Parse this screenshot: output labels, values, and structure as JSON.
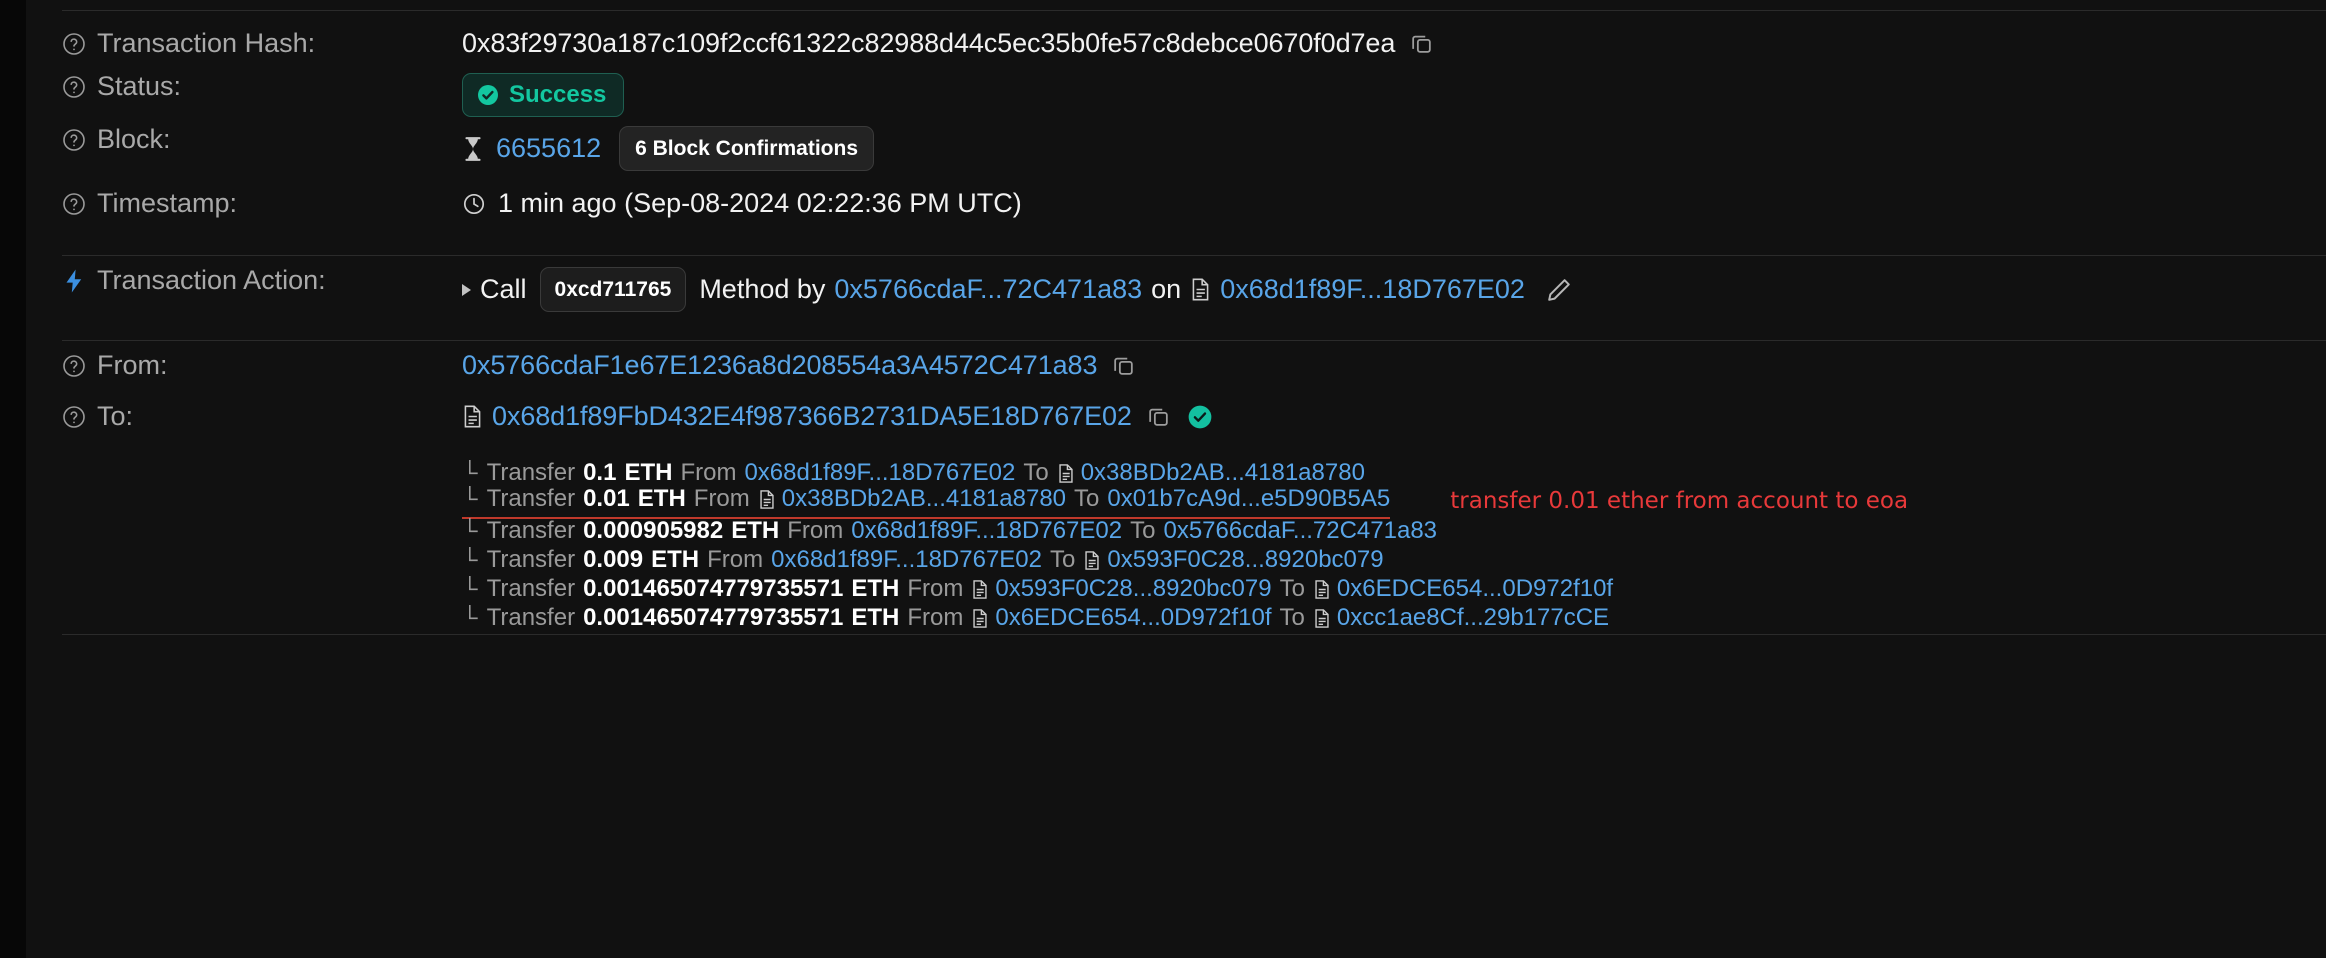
{
  "rows": {
    "transaction_hash": {
      "label": "Transaction Hash:",
      "value": "0x83f29730a187c109f2ccf61322c82988d44c5ec35b0fe57c8debce0670f0d7ea",
      "copy_icon": "copy-icon",
      "help_icon": "help-circle-icon"
    },
    "status": {
      "label": "Status:",
      "value": "Success",
      "badge_icon": "check-circle-icon",
      "badge_color": "#13c7a0",
      "badge_bg": "#0f2a25",
      "badge_border": "#1f5f51",
      "help_icon": "help-circle-icon"
    },
    "block": {
      "label": "Block:",
      "number": "6655612",
      "confirmations": "6 Block Confirmations",
      "block_icon": "hourglass-icon",
      "help_icon": "help-circle-icon"
    },
    "timestamp": {
      "label": "Timestamp:",
      "value": "1 min ago (Sep-08-2024 02:22:36 PM UTC)",
      "clock_icon": "clock-icon",
      "help_icon": "help-circle-icon"
    },
    "transaction_action": {
      "label": "Transaction Action:",
      "bolt_icon": "lightning-bolt-icon",
      "caret_icon": "caret-right-icon",
      "call_word": "Call",
      "method_id": "0xcd711765",
      "method_by_word": "Method by",
      "caller": "0x5766cdaF...72C471a83",
      "on_word": "on",
      "contract": "0x68d1f89F...18D767E02",
      "contract_icon": "contract-document-icon",
      "edit_icon": "pencil-icon"
    },
    "from": {
      "label": "From:",
      "value": "0x5766cdaF1e67E1236a8d208554a3A4572C471a83",
      "copy_icon": "copy-icon",
      "help_icon": "help-circle-icon"
    },
    "to": {
      "label": "To:",
      "value": "0x68d1f89FbD432E4f987366B2731DA5E18D767E02",
      "contract_icon": "contract-document-icon",
      "copy_icon": "copy-icon",
      "verified_icon": "verified-check-icon",
      "help_icon": "help-circle-icon"
    }
  },
  "transfers": {
    "prefix": "Transfer",
    "from_word": "From",
    "to_word": "To",
    "eth_unit": "ETH",
    "corner_glyph": "└",
    "items": [
      {
        "amount": "0.1",
        "from": "0x68d1f89F...18D767E02",
        "from_is_contract": false,
        "to": "0x38BDb2AB...4181a8780",
        "to_is_contract": true,
        "annotation": "",
        "underlined": false
      },
      {
        "amount": "0.01",
        "from": "0x38BDb2AB...4181a8780",
        "from_is_contract": true,
        "to": "0x01b7cA9d...e5D90B5A5",
        "to_is_contract": false,
        "annotation": "transfer 0.01 ether from account to eoa",
        "underlined": true
      },
      {
        "amount": "0.000905982",
        "from": "0x68d1f89F...18D767E02",
        "from_is_contract": false,
        "to": "0x5766cdaF...72C471a83",
        "to_is_contract": false,
        "annotation": "",
        "underlined": false
      },
      {
        "amount": "0.009",
        "from": "0x68d1f89F...18D767E02",
        "from_is_contract": false,
        "to": "0x593F0C28...8920bc079",
        "to_is_contract": true,
        "annotation": "",
        "underlined": false
      },
      {
        "amount": "0.001465074779735571",
        "from": "0x593F0C28...8920bc079",
        "from_is_contract": true,
        "to": "0x6EDCE654...0D972f10f",
        "to_is_contract": true,
        "annotation": "",
        "underlined": false
      },
      {
        "amount": "0.001465074779735571",
        "from": "0x6EDCE654...0D972f10f",
        "from_is_contract": true,
        "to": "0xcc1ae8Cf...29b177cCE",
        "to_is_contract": true,
        "annotation": "",
        "underlined": false
      }
    ]
  },
  "colors": {
    "link": "#59a5e8",
    "success": "#13c7a0",
    "annotation": "#e8393a",
    "background": "#111111",
    "label": "#a9a9a9"
  }
}
